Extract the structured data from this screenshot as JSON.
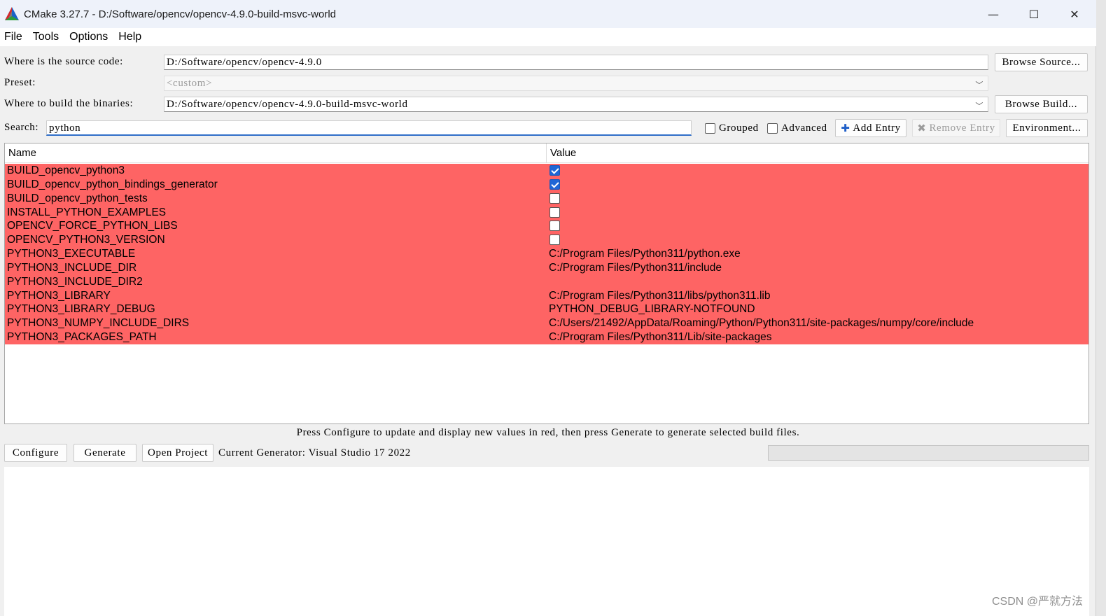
{
  "window": {
    "title": "CMake 3.27.7 - D:/Software/opencv/opencv-4.9.0-build-msvc-world",
    "minimize_glyph": "—",
    "maximize_glyph": "☐",
    "close_glyph": "✕"
  },
  "menu": [
    "File",
    "Tools",
    "Options",
    "Help"
  ],
  "source": {
    "label": "Where is the source code:",
    "value": "D:/Software/opencv/opencv-4.9.0",
    "browse": "Browse Source..."
  },
  "preset": {
    "label": "Preset:",
    "value": "<custom>"
  },
  "build": {
    "label": "Where to build the binaries:",
    "value": "D:/Software/opencv/opencv-4.9.0-build-msvc-world",
    "browse": "Browse Build..."
  },
  "search": {
    "label": "Search:",
    "value": "python"
  },
  "options": {
    "grouped": "Grouped",
    "advanced": "Advanced",
    "add_entry": "Add Entry",
    "remove_entry": "Remove Entry",
    "environment": "Environment..."
  },
  "table": {
    "headers": [
      "Name",
      "Value"
    ],
    "highlight_color": "#fe6464",
    "rows": [
      {
        "name": "BUILD_opencv_python3",
        "type": "bool",
        "checked": true,
        "value": ""
      },
      {
        "name": "BUILD_opencv_python_bindings_generator",
        "type": "bool",
        "checked": true,
        "value": ""
      },
      {
        "name": "BUILD_opencv_python_tests",
        "type": "bool",
        "checked": false,
        "value": ""
      },
      {
        "name": "INSTALL_PYTHON_EXAMPLES",
        "type": "bool",
        "checked": false,
        "value": ""
      },
      {
        "name": "OPENCV_FORCE_PYTHON_LIBS",
        "type": "bool",
        "checked": false,
        "value": ""
      },
      {
        "name": "OPENCV_PYTHON3_VERSION",
        "type": "bool",
        "checked": false,
        "value": ""
      },
      {
        "name": "PYTHON3_EXECUTABLE",
        "type": "text",
        "value": "C:/Program Files/Python311/python.exe"
      },
      {
        "name": "PYTHON3_INCLUDE_DIR",
        "type": "text",
        "value": "C:/Program Files/Python311/include"
      },
      {
        "name": "PYTHON3_INCLUDE_DIR2",
        "type": "text",
        "value": ""
      },
      {
        "name": "PYTHON3_LIBRARY",
        "type": "text",
        "value": "C:/Program Files/Python311/libs/python311.lib"
      },
      {
        "name": "PYTHON3_LIBRARY_DEBUG",
        "type": "text",
        "value": "PYTHON_DEBUG_LIBRARY-NOTFOUND"
      },
      {
        "name": "PYTHON3_NUMPY_INCLUDE_DIRS",
        "type": "text",
        "value": "C:/Users/21492/AppData/Roaming/Python/Python311/site-packages/numpy/core/include"
      },
      {
        "name": "PYTHON3_PACKAGES_PATH",
        "type": "text",
        "value": "C:/Program Files/Python311/Lib/site-packages"
      }
    ]
  },
  "hint": "Press Configure to update and display new values in red, then press Generate to generate selected build files.",
  "actions": {
    "configure": "Configure",
    "generate": "Generate",
    "open_project": "Open Project",
    "generator": "Current Generator: Visual Studio 17 2022"
  },
  "watermark": "CSDN @严就方法"
}
